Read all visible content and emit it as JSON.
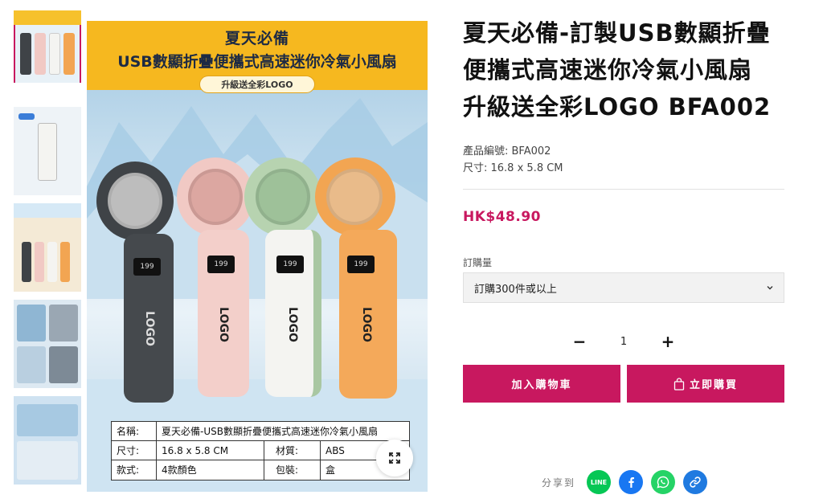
{
  "gallery": {
    "thumbnails": [
      "thumb-1",
      "thumb-2",
      "thumb-3",
      "thumb-4",
      "thumb-5"
    ],
    "banner_line1": "夏天必備",
    "banner_line2": "USB數顯折疊便攜式高速迷你冷氣小風扇",
    "banner_pill": "升級送全彩LOGO",
    "fan_display": "199",
    "fan_logo": "LOGO",
    "fan_colors": [
      "#3f4347",
      "#f1c9c4",
      "#f4f4f1",
      "#f2a552"
    ],
    "spec_table": {
      "name_key": "名稱:",
      "name_val": "夏天必備-USB數顯折疊便攜式高速迷你冷氣小風扇",
      "size_key": "尺寸:",
      "size_val": "16.8 x 5.8 CM",
      "material_key": "材質:",
      "material_val": "ABS",
      "style_key": "款式:",
      "style_val": "4款顏色",
      "package_key": "包裝:",
      "package_val": "盒"
    }
  },
  "product": {
    "title": "夏天必備-訂製USB數顯折疊便攜式高速迷你冷氣小風扇 升級送全彩LOGO BFA002",
    "code_line": "產品編號: BFA002",
    "size_line": "尺寸: 16.8 x 5.8 CM",
    "price": "HK$48.90",
    "qty_label": "訂購量",
    "qty_option": "訂購300件或以上",
    "quantity": "1",
    "minus": "−",
    "plus": "+",
    "add_to_cart": "加入購物車",
    "buy_now": "立即購買"
  },
  "share": {
    "label": "分享到",
    "line_text": "LINE"
  },
  "colors": {
    "accent": "#c8185f",
    "banner": "#f6b81f",
    "line": "#06c755",
    "facebook": "#1877f2",
    "whatsapp": "#25d366",
    "link": "#1f7ae0"
  }
}
